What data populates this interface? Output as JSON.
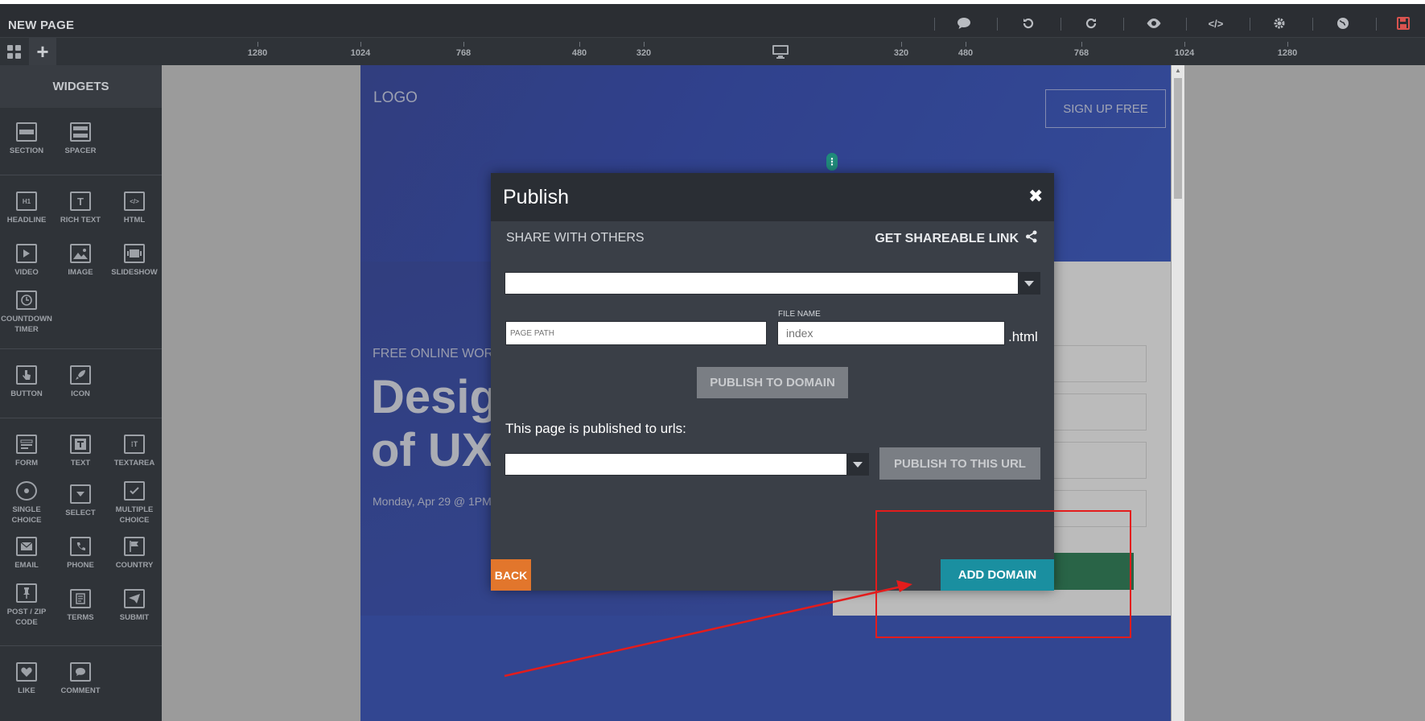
{
  "app": {
    "page_title": "NEW PAGE"
  },
  "toolbar": {
    "icons": [
      "comment-icon",
      "undo-icon",
      "redo-icon",
      "preview-eye-icon",
      "code-icon",
      "settings-gear-icon",
      "globe-icon",
      "save-icon"
    ],
    "save_color": "#d9534f"
  },
  "ruler": {
    "labels_left": [
      "1280",
      "1024",
      "768",
      "480",
      "320"
    ],
    "labels_right": [
      "320",
      "480",
      "768",
      "1024",
      "1280"
    ],
    "device": "desktop-monitor-icon"
  },
  "sidebar": {
    "title": "WIDGETS",
    "widgets": {
      "section": "SECTION",
      "spacer": "SPACER",
      "headline": "HEADLINE",
      "rich_text": "RICH TEXT",
      "html": "HTML",
      "video": "VIDEO",
      "image": "IMAGE",
      "slideshow": "SLIDESHOW",
      "countdown": "COUNTDOWN TIMER",
      "button": "BUTTON",
      "icon": "ICON",
      "form": "FORM",
      "text": "TEXT",
      "textarea": "TEXTAREA",
      "single_choice": "SINGLE CHOICE",
      "select": "SELECT",
      "multiple_choice": "MULTIPLE CHOICE",
      "email": "EMAIL",
      "phone": "PHONE",
      "country": "COUNTRY",
      "post_zip": "POST / ZIP CODE",
      "terms": "TERMS",
      "submit": "SUBMIT",
      "like": "LIKE",
      "comment": "COMMENT"
    }
  },
  "page": {
    "logo": "LOGO",
    "signup": "SIGN UP FREE",
    "workshop": "FREE ONLINE WORK",
    "hero_title": "Desig\nof UX",
    "hero_date": "Monday, Apr 29 @ 1PM"
  },
  "modal": {
    "title": "Publish",
    "share_label": "SHARE WITH OTHERS",
    "share_link": "GET SHAREABLE LINK",
    "page_path_placeholder": "PAGE PATH",
    "file_name_label": "FILE NAME",
    "file_name_placeholder": "index",
    "html_suffix": ".html",
    "publish_domain": "PUBLISH TO DOMAIN",
    "published_label": "This page is published to urls:",
    "publish_url": "PUBLISH TO THIS URL",
    "back": "BACK",
    "add_domain": "ADD DOMAIN"
  },
  "colors": {
    "back_button": "#e2762c",
    "add_domain_button": "#1a8fa0",
    "annotation": "#e31c1c"
  }
}
